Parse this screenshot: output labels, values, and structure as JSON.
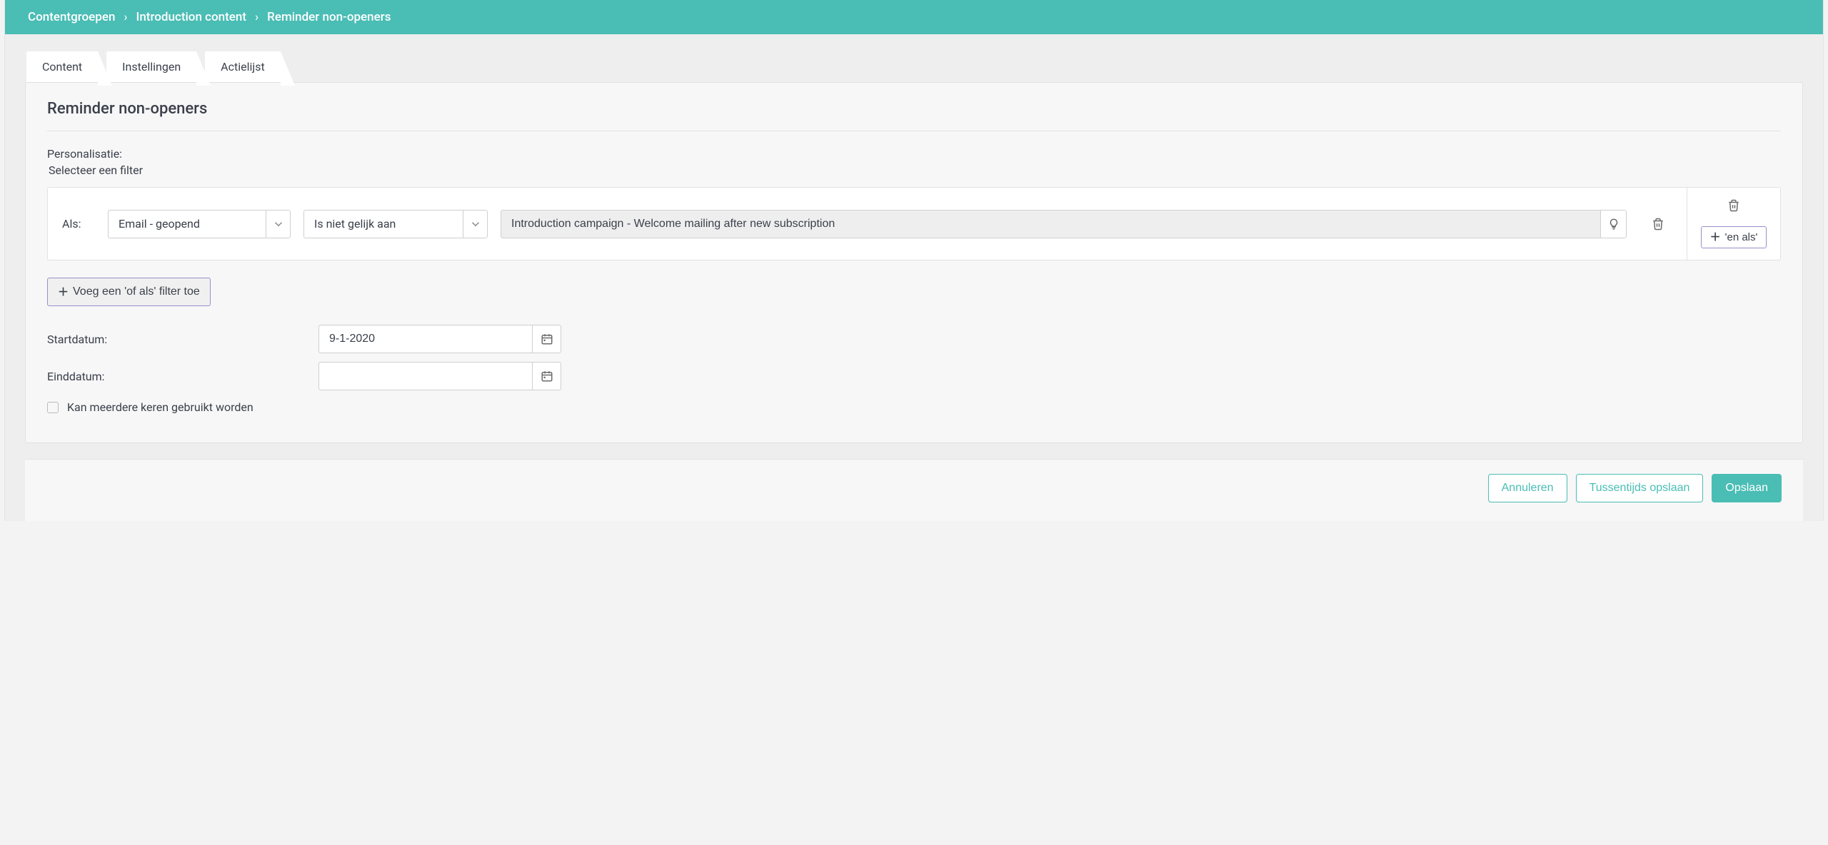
{
  "breadcrumb": {
    "items": [
      "Contentgroepen",
      "Introduction content",
      "Reminder non-openers"
    ]
  },
  "tabs": {
    "items": [
      {
        "label": "Content"
      },
      {
        "label": "Instellingen"
      },
      {
        "label": "Actielijst"
      }
    ]
  },
  "page": {
    "title": "Reminder non-openers"
  },
  "personalisation": {
    "label": "Personalisatie:",
    "sub_label": "Selecteer een filter",
    "filter": {
      "prefix": "Als:",
      "field_value": "Email - geopend",
      "operator_value": "Is niet gelijk aan",
      "value": "Introduction campaign - Welcome mailing after new subscription",
      "and_label": "'en als'",
      "or_button": "Voeg een 'of als' filter toe"
    }
  },
  "dates": {
    "start_label": "Startdatum:",
    "start_value": "9-1-2020",
    "end_label": "Einddatum:",
    "end_value": ""
  },
  "reuse": {
    "label": "Kan meerdere keren gebruikt worden"
  },
  "actions": {
    "cancel": "Annuleren",
    "draft": "Tussentijds opslaan",
    "save": "Opslaan"
  }
}
